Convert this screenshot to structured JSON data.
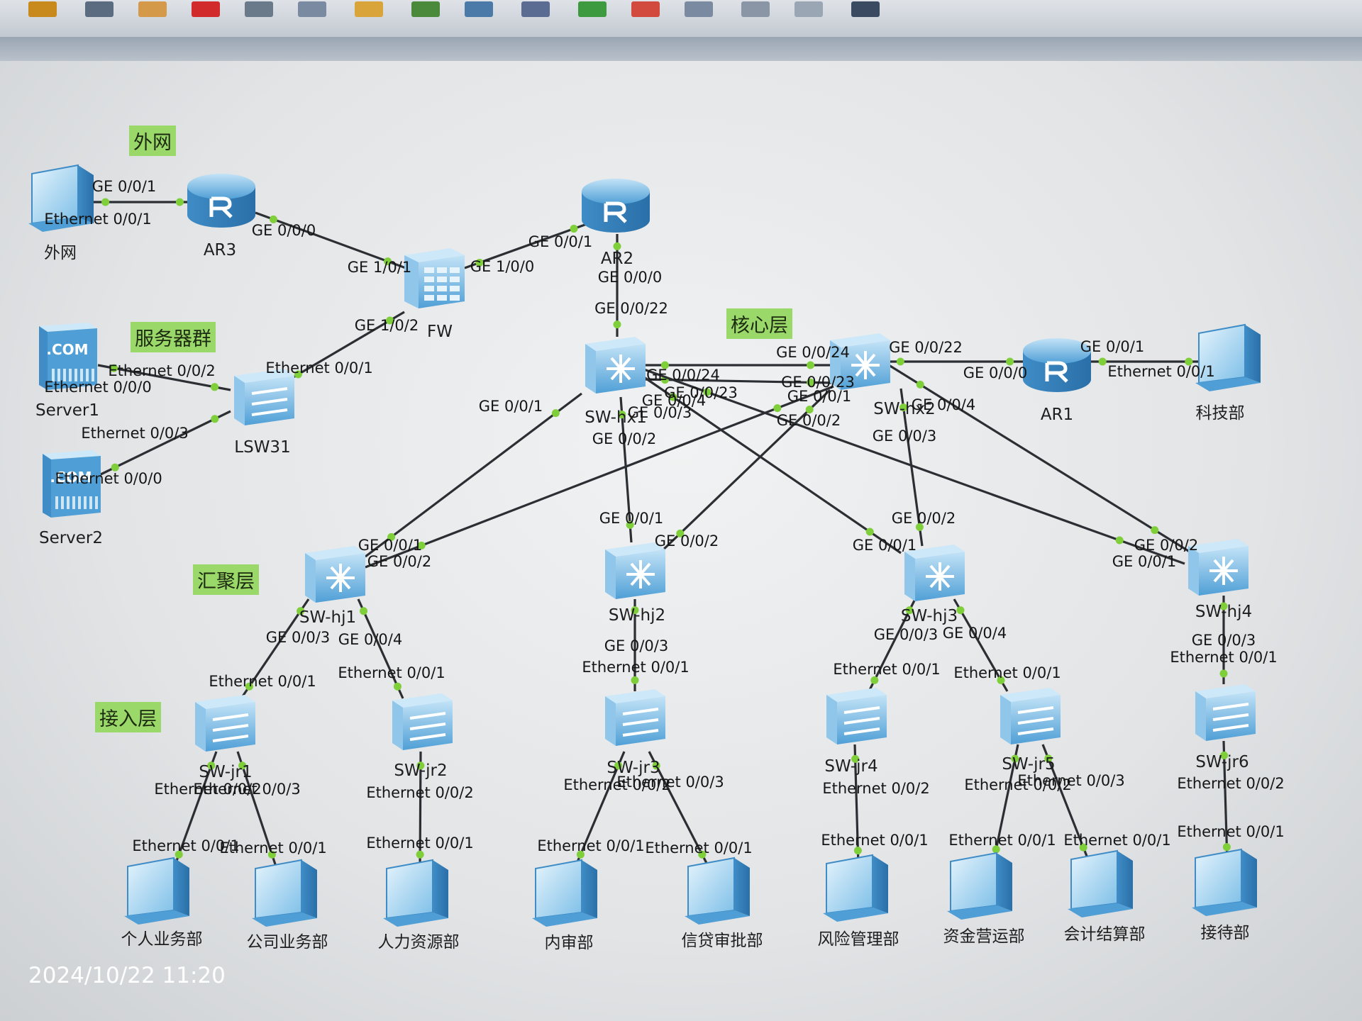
{
  "toolbar": {
    "buttons": [
      {
        "icon": "undo-icon",
        "color": "#c98a1d"
      },
      {
        "icon": "select-icon",
        "color": "#5b6b80"
      },
      {
        "icon": "hand-icon",
        "color": "#d49a4a"
      },
      {
        "icon": "delete-icon",
        "color": "#d22b2b"
      },
      {
        "icon": "delete-link-icon",
        "color": "#6a7a8a"
      },
      {
        "icon": "text-icon",
        "color": "#7a8aa0"
      },
      {
        "icon": "palette-icon",
        "color": "#d9a43a"
      },
      {
        "icon": "zoom-in-icon",
        "color": "#4b8a3a"
      },
      {
        "icon": "zoom-out-icon",
        "color": "#4b7aa8"
      },
      {
        "icon": "fit-icon",
        "color": "#5b6c92"
      },
      {
        "icon": "start-icon",
        "color": "#3e9a3e"
      },
      {
        "icon": "stop-icon",
        "color": "#d24a3e"
      },
      {
        "icon": "capture-icon",
        "color": "#7a8aa0"
      },
      {
        "icon": "cli-icon",
        "color": "#8a96a6"
      },
      {
        "icon": "grid-icon",
        "color": "#9aa6b3"
      },
      {
        "icon": "topology-icon",
        "color": "#3a4a60"
      }
    ]
  },
  "tags": {
    "outside": "外网",
    "servers": "服务器群",
    "core": "核心层",
    "aggregation": "汇聚层",
    "access": "接入层"
  },
  "devices": {
    "outside_pc": "外网",
    "ar3": "AR3",
    "ar2": "AR2",
    "fw": "FW",
    "server1": "Server1",
    "server2": "Server2",
    "lsw31": "LSW31",
    "swhx1": "SW-hx1",
    "swhx2": "SW-hx2",
    "ar1": "AR1",
    "keji": "科技部",
    "swhj1": "SW-hj1",
    "swhj2": "SW-hj2",
    "swhj3": "SW-hj3",
    "swhj4": "SW-hj4",
    "swjr1": "SW-jr1",
    "swjr2": "SW-jr2",
    "swjr3": "SW-jr3",
    "swjr4": "SW-jr4",
    "swjr5": "SW-jr5",
    "swjr6": "SW-jr6",
    "server_tag": ".COM",
    "pc1": "个人业务部",
    "pc2": "公司业务部",
    "pc3": "人力资源部",
    "pc4": "内审部",
    "pc5": "信贷审批部",
    "pc6": "风险管理部",
    "pc7": "资金营运部",
    "pc8": "会计结算部",
    "pc9": "接待部"
  },
  "ports": {
    "p_outside_ar3_a": "GE 0/0/1",
    "p_outside_ar3_b": "Ethernet 0/0/1",
    "p_ar3_fw_a": "GE 0/0/0",
    "p_ar3_fw_b": "GE 1/0/1",
    "p_fw_ar2_a": "GE 1/0/0",
    "p_fw_ar2_b": "GE 0/0/1",
    "p_ar2_hx1_a": "GE 0/0/0",
    "p_ar2_hx1_b": "GE 0/0/22",
    "p_fw_lsw_a": "GE 1/0/2",
    "p_fw_lsw_b": "Ethernet 0/0/1",
    "p_s1_lsw_a": "Ethernet 0/0/0",
    "p_s1_lsw_b": "Ethernet 0/0/2",
    "p_s2_lsw_a": "Ethernet 0/0/0",
    "p_s2_lsw_b": "Ethernet 0/0/3",
    "p_hx1_hx2_a": "GE 0/0/24",
    "p_hx1_hx2_b": "GE 0/0/24",
    "p_hx1_hx2_c": "GE 0/0/23",
    "p_hx1_hx2_d": "GE 0/0/23",
    "p_hx1_hj1": "GE 0/0/1",
    "p_hx1_hj2": "GE 0/0/2",
    "p_hx1_hj3": "GE 0/0/3",
    "p_hx1_hj4": "GE 0/0/4",
    "p_hx2_ar1_a": "GE 0/0/22",
    "p_hx2_ar1_b": "GE 0/0/0",
    "p_ar1_keji_a": "GE 0/0/1",
    "p_ar1_keji_b": "Ethernet 0/0/1",
    "p_hx2_hj1": "GE 0/0/1",
    "p_hx2_hj2": "GE 0/0/2",
    "p_hx2_hj3": "GE 0/0/3",
    "p_hx2_hj4": "GE 0/0/4",
    "p_hj1_up1": "GE 0/0/1",
    "p_hj1_up2": "GE 0/0/2",
    "p_hj2_up1": "GE 0/0/1",
    "p_hj2_up2": "GE 0/0/2",
    "p_hj3_up1": "GE 0/0/1",
    "p_hj3_up2": "GE 0/0/2",
    "p_hj4_up1": "GE 0/0/1",
    "p_hj4_up2": "GE 0/0/2",
    "p_hj1_jr1_a": "GE 0/0/3",
    "p_hj1_jr1_b": "Ethernet 0/0/1",
    "p_hj1_jr2_a": "GE 0/0/4",
    "p_hj1_jr2_b": "Ethernet 0/0/1",
    "p_hj2_jr3_a": "GE 0/0/3",
    "p_hj2_jr3_b": "Ethernet 0/0/1",
    "p_hj3_jr4_a": "GE 0/0/3",
    "p_hj3_jr4_b": "Ethernet 0/0/1",
    "p_hj3_jr5_a": "GE 0/0/4",
    "p_hj3_jr5_b": "Ethernet 0/0/1",
    "p_hj4_jr6_a": "GE 0/0/3",
    "p_hj4_jr6_b": "Ethernet 0/0/1",
    "p_jr1_pc1_a": "Ethernet 0/0/2",
    "p_jr1_pc1_b": "Ethernet 0/0/1",
    "p_jr1_pc2_a": "Ethernet 0/0/3",
    "p_jr1_pc2_b": "Ethernet 0/0/1",
    "p_jr2_pc3_a": "Ethernet 0/0/2",
    "p_jr2_pc3_b": "Ethernet 0/0/1",
    "p_jr3_pc4_a": "Ethernet 0/0/2",
    "p_jr3_pc4_b": "Ethernet 0/0/1",
    "p_jr3_pc5_a": "Ethernet 0/0/3",
    "p_jr3_pc5_b": "Ethernet 0/0/1",
    "p_jr4_pc6_a": "Ethernet 0/0/2",
    "p_jr4_pc6_b": "Ethernet 0/0/1",
    "p_jr5_pc7_a": "Ethernet 0/0/2",
    "p_jr5_pc7_b": "Ethernet 0/0/1",
    "p_jr5_pc8_a": "Ethernet 0/0/3",
    "p_jr5_pc8_b": "Ethernet 0/0/1",
    "p_jr6_pc9_a": "Ethernet 0/0/2",
    "p_jr6_pc9_b": "Ethernet 0/0/1"
  },
  "colors": {
    "device_blue": "#5aa9de",
    "device_light": "#a9d4f2",
    "link": "#2b2f33",
    "port_dot": "#7fcf3a",
    "tag_bg": "#9ad86a"
  },
  "timestamp": "2024/10/22 11:20"
}
